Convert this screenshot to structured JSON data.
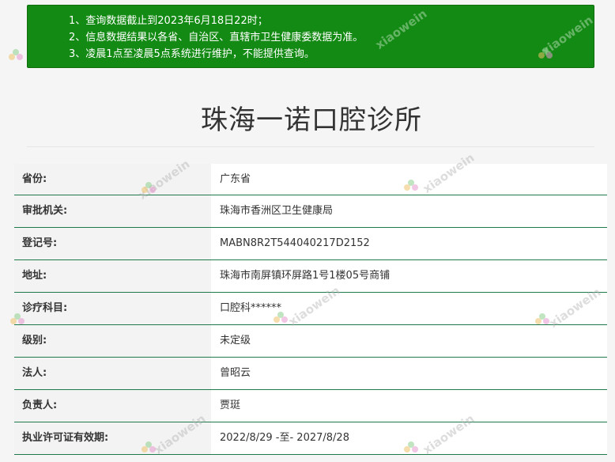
{
  "notice": {
    "lines": [
      "1、查询数据截止到2023年6月18日22时；",
      "2、信息数据结果以各省、自治区、直辖市卫生健康委数据为准。",
      "3、凌晨1点至凌晨5点系统进行维护，不能提供查询。"
    ]
  },
  "title": "珠海一诺口腔诊所",
  "rows": [
    {
      "label": "省份:",
      "value": "广东省"
    },
    {
      "label": "审批机关:",
      "value": "珠海市香洲区卫生健康局"
    },
    {
      "label": "登记号:",
      "value": "MABN8R2T544040217D2152"
    },
    {
      "label": "地址:",
      "value": "珠海市南屏镇环屏路1号1楼05号商铺"
    },
    {
      "label": "诊疗科目:",
      "value": "口腔科******"
    },
    {
      "label": "级别:",
      "value": "未定级"
    },
    {
      "label": "法人:",
      "value": "曾昭云"
    },
    {
      "label": "负责人:",
      "value": "贾珽"
    },
    {
      "label": "执业许可证有效期:",
      "value": "2022/8/29 -至- 2027/8/28"
    }
  ],
  "watermark": {
    "text": "xiaowein",
    "logo_icon": "flower-logo-icon"
  },
  "colors": {
    "notice_bg": "#138a13",
    "row_border": "#1e7a4a"
  }
}
